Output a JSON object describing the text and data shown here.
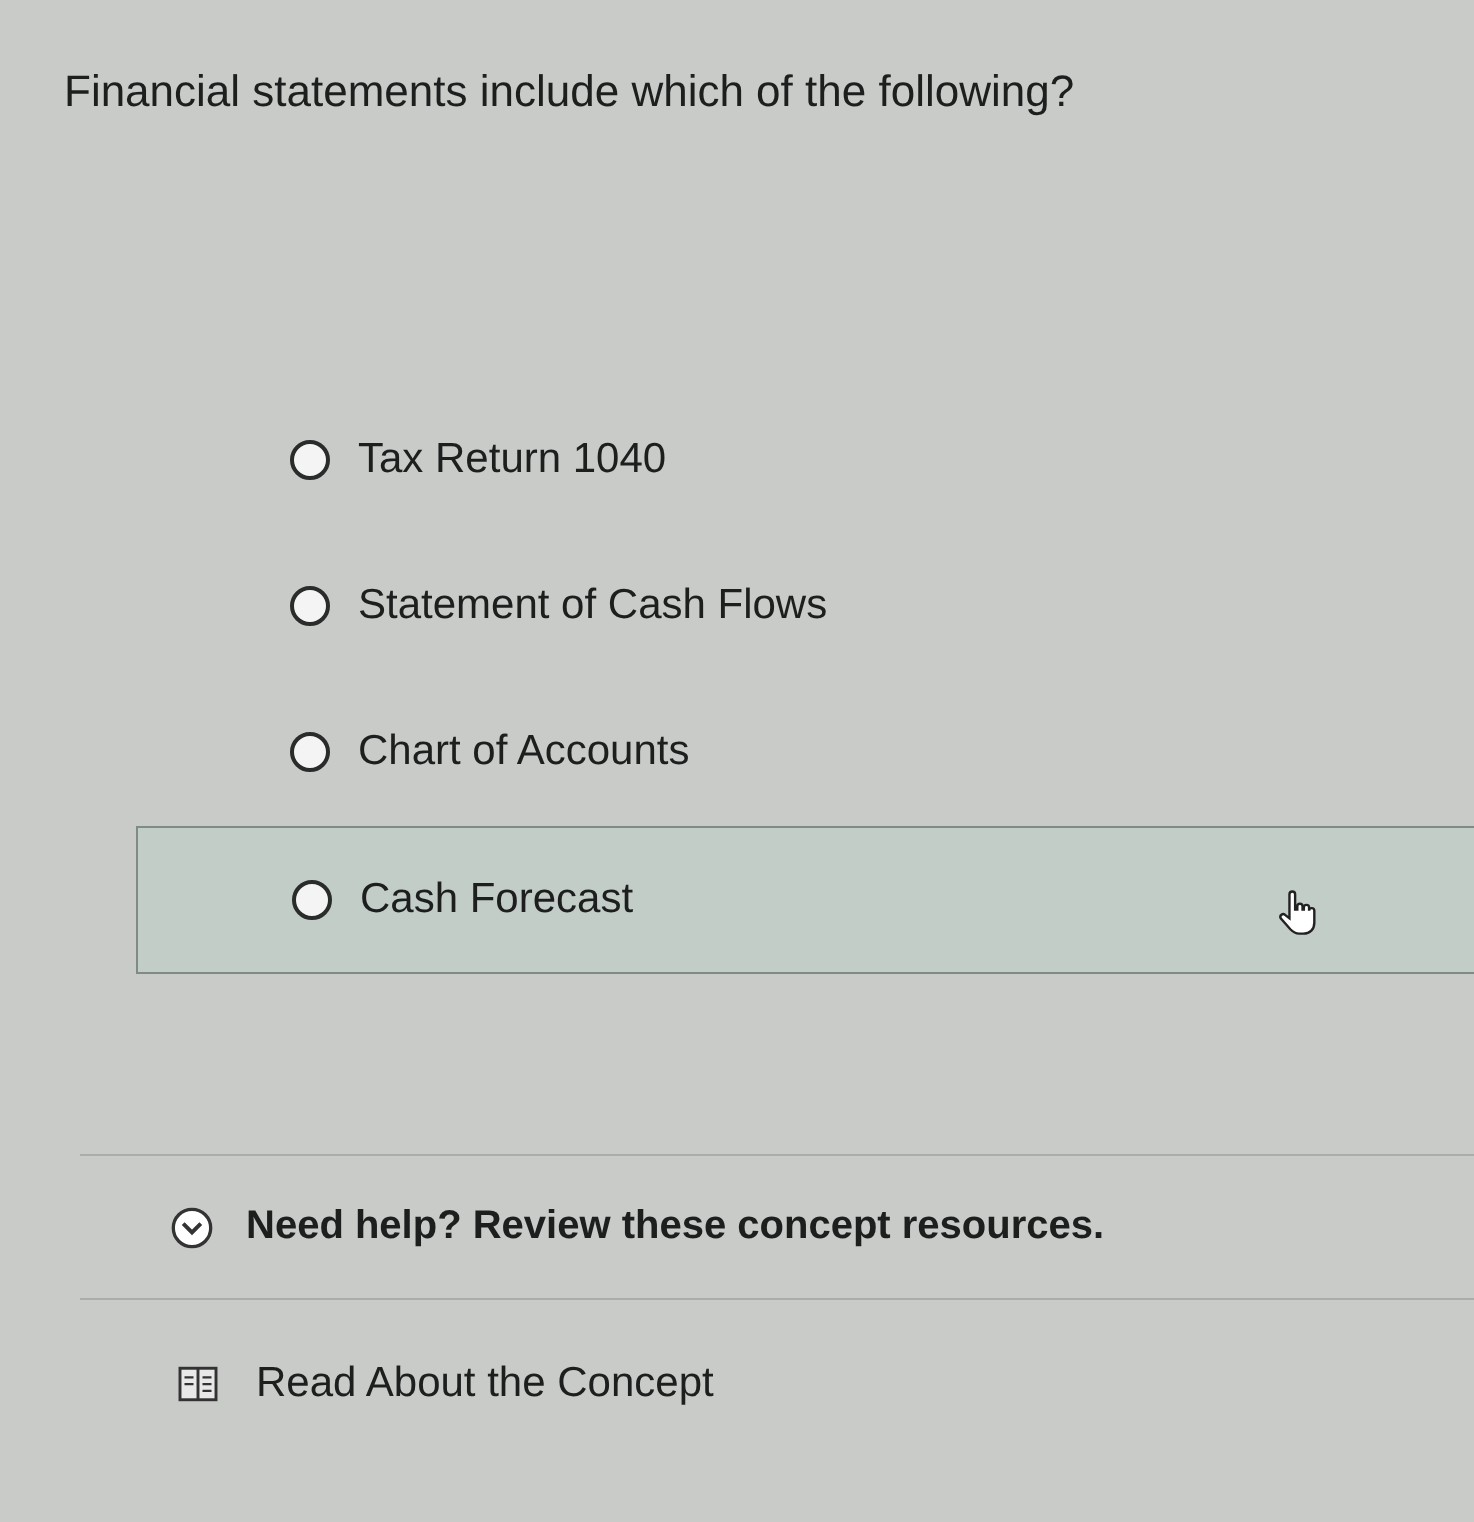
{
  "question": "Financial statements include which of the following?",
  "options": [
    {
      "label": "Tax Return 1040",
      "selected": false,
      "hovered": false
    },
    {
      "label": "Statement of Cash Flows",
      "selected": false,
      "hovered": false
    },
    {
      "label": "Chart of Accounts",
      "selected": false,
      "hovered": false
    },
    {
      "label": "Cash Forecast",
      "selected": false,
      "hovered": true
    }
  ],
  "help": {
    "title": "Need help? Review these concept resources.",
    "expanded": false,
    "resources": [
      {
        "label": "Read About the Concept"
      }
    ]
  }
}
